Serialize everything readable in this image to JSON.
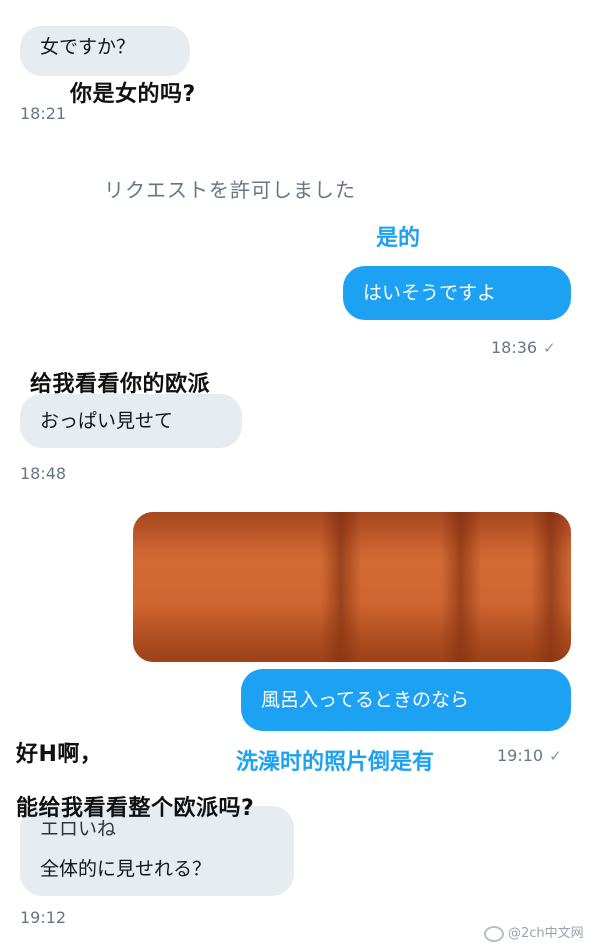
{
  "messages": {
    "m1": {
      "text": "女ですか？",
      "time": "18:21"
    },
    "system": {
      "text": "リクエストを許可しました"
    },
    "m2": {
      "text": "はいそうですよ",
      "time": "18:36",
      "check": "✓"
    },
    "m3": {
      "text": "おっぱい見せて",
      "time": "18:48"
    },
    "m4": {
      "text": "風呂入ってるときのなら",
      "time": "19:10",
      "check": "✓"
    },
    "m5": {
      "line1": "エロいね",
      "line2": "全体的に見せれる？",
      "time": "19:12"
    }
  },
  "captions": {
    "c1": "你是女的吗?",
    "c2": "是的",
    "c3": "给我看看你的欧派",
    "c4": "洗澡时的照片倒是有",
    "c5_line1": "好H啊，",
    "c5_line2": "能给我看看整个欧派吗?"
  },
  "watermark": {
    "text": "@2ch中文网"
  },
  "colors": {
    "incoming_bubble": "#e6ecf0",
    "outgoing_bubble": "#1da1f2",
    "caption_blue": "#1da1f2"
  },
  "icons": {
    "weibo": "weibo-logo-icon",
    "read": "checkmark-icon"
  }
}
